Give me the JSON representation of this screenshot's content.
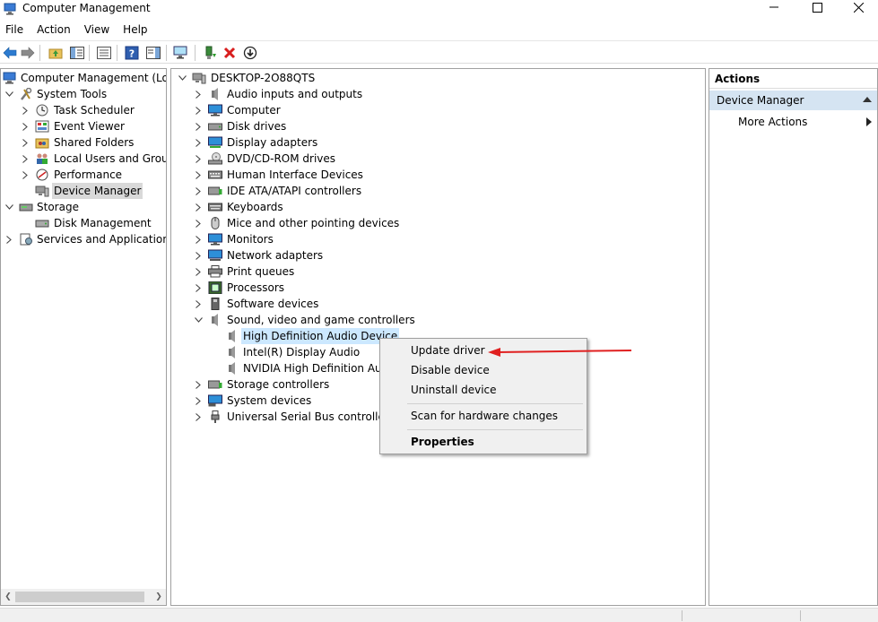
{
  "window": {
    "title": "Computer Management"
  },
  "menubar": {
    "items": [
      "File",
      "Action",
      "View",
      "Help"
    ]
  },
  "left_tree": {
    "root": "Computer Management (Local",
    "items": [
      {
        "label": "System Tools",
        "icon": "tools-icon"
      },
      {
        "label": "Task Scheduler",
        "icon": "clock-icon"
      },
      {
        "label": "Event Viewer",
        "icon": "event-viewer-icon"
      },
      {
        "label": "Shared Folders",
        "icon": "shared-folder-icon"
      },
      {
        "label": "Local Users and Groups",
        "icon": "users-icon"
      },
      {
        "label": "Performance",
        "icon": "performance-icon"
      },
      {
        "label": "Device Manager",
        "icon": "device-manager-icon"
      },
      {
        "label": "Storage",
        "icon": "storage-icon"
      },
      {
        "label": "Disk Management",
        "icon": "disk-icon"
      },
      {
        "label": "Services and Applications",
        "icon": "services-icon"
      }
    ]
  },
  "device_tree": {
    "root": "DESKTOP-2O88QTS",
    "categories": [
      "Audio inputs and outputs",
      "Computer",
      "Disk drives",
      "Display adapters",
      "DVD/CD-ROM drives",
      "Human Interface Devices",
      "IDE ATA/ATAPI controllers",
      "Keyboards",
      "Mice and other pointing devices",
      "Monitors",
      "Network adapters",
      "Print queues",
      "Processors",
      "Software devices",
      "Sound, video and game controllers"
    ],
    "sound_children": [
      "High Definition Audio Device",
      "Intel(R) Display Audio",
      "NVIDIA High Definition Audi"
    ],
    "trailing_categories": [
      "Storage controllers",
      "System devices",
      "Universal Serial Bus controllers"
    ]
  },
  "actions_pane": {
    "header": "Actions",
    "section": "Device Manager",
    "more": "More Actions"
  },
  "context_menu": {
    "items": [
      "Update driver",
      "Disable device",
      "Uninstall device",
      "Scan for hardware changes",
      "Properties"
    ]
  },
  "colors": {
    "selection": "#cce8ff",
    "section": "#d5e4f2",
    "arrow": "#e02020"
  }
}
